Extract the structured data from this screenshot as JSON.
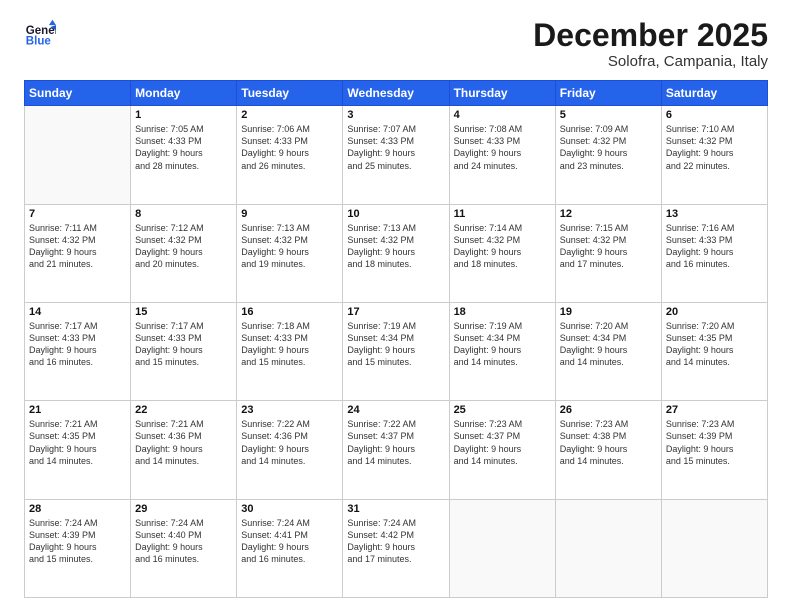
{
  "logo": {
    "line1": "General",
    "line2": "Blue"
  },
  "title": "December 2025",
  "location": "Solofra, Campania, Italy",
  "weekdays": [
    "Sunday",
    "Monday",
    "Tuesday",
    "Wednesday",
    "Thursday",
    "Friday",
    "Saturday"
  ],
  "weeks": [
    [
      {
        "day": "",
        "info": ""
      },
      {
        "day": "1",
        "info": "Sunrise: 7:05 AM\nSunset: 4:33 PM\nDaylight: 9 hours\nand 28 minutes."
      },
      {
        "day": "2",
        "info": "Sunrise: 7:06 AM\nSunset: 4:33 PM\nDaylight: 9 hours\nand 26 minutes."
      },
      {
        "day": "3",
        "info": "Sunrise: 7:07 AM\nSunset: 4:33 PM\nDaylight: 9 hours\nand 25 minutes."
      },
      {
        "day": "4",
        "info": "Sunrise: 7:08 AM\nSunset: 4:33 PM\nDaylight: 9 hours\nand 24 minutes."
      },
      {
        "day": "5",
        "info": "Sunrise: 7:09 AM\nSunset: 4:32 PM\nDaylight: 9 hours\nand 23 minutes."
      },
      {
        "day": "6",
        "info": "Sunrise: 7:10 AM\nSunset: 4:32 PM\nDaylight: 9 hours\nand 22 minutes."
      }
    ],
    [
      {
        "day": "7",
        "info": "Sunrise: 7:11 AM\nSunset: 4:32 PM\nDaylight: 9 hours\nand 21 minutes."
      },
      {
        "day": "8",
        "info": "Sunrise: 7:12 AM\nSunset: 4:32 PM\nDaylight: 9 hours\nand 20 minutes."
      },
      {
        "day": "9",
        "info": "Sunrise: 7:13 AM\nSunset: 4:32 PM\nDaylight: 9 hours\nand 19 minutes."
      },
      {
        "day": "10",
        "info": "Sunrise: 7:13 AM\nSunset: 4:32 PM\nDaylight: 9 hours\nand 18 minutes."
      },
      {
        "day": "11",
        "info": "Sunrise: 7:14 AM\nSunset: 4:32 PM\nDaylight: 9 hours\nand 18 minutes."
      },
      {
        "day": "12",
        "info": "Sunrise: 7:15 AM\nSunset: 4:32 PM\nDaylight: 9 hours\nand 17 minutes."
      },
      {
        "day": "13",
        "info": "Sunrise: 7:16 AM\nSunset: 4:33 PM\nDaylight: 9 hours\nand 16 minutes."
      }
    ],
    [
      {
        "day": "14",
        "info": "Sunrise: 7:17 AM\nSunset: 4:33 PM\nDaylight: 9 hours\nand 16 minutes."
      },
      {
        "day": "15",
        "info": "Sunrise: 7:17 AM\nSunset: 4:33 PM\nDaylight: 9 hours\nand 15 minutes."
      },
      {
        "day": "16",
        "info": "Sunrise: 7:18 AM\nSunset: 4:33 PM\nDaylight: 9 hours\nand 15 minutes."
      },
      {
        "day": "17",
        "info": "Sunrise: 7:19 AM\nSunset: 4:34 PM\nDaylight: 9 hours\nand 15 minutes."
      },
      {
        "day": "18",
        "info": "Sunrise: 7:19 AM\nSunset: 4:34 PM\nDaylight: 9 hours\nand 14 minutes."
      },
      {
        "day": "19",
        "info": "Sunrise: 7:20 AM\nSunset: 4:34 PM\nDaylight: 9 hours\nand 14 minutes."
      },
      {
        "day": "20",
        "info": "Sunrise: 7:20 AM\nSunset: 4:35 PM\nDaylight: 9 hours\nand 14 minutes."
      }
    ],
    [
      {
        "day": "21",
        "info": "Sunrise: 7:21 AM\nSunset: 4:35 PM\nDaylight: 9 hours\nand 14 minutes."
      },
      {
        "day": "22",
        "info": "Sunrise: 7:21 AM\nSunset: 4:36 PM\nDaylight: 9 hours\nand 14 minutes."
      },
      {
        "day": "23",
        "info": "Sunrise: 7:22 AM\nSunset: 4:36 PM\nDaylight: 9 hours\nand 14 minutes."
      },
      {
        "day": "24",
        "info": "Sunrise: 7:22 AM\nSunset: 4:37 PM\nDaylight: 9 hours\nand 14 minutes."
      },
      {
        "day": "25",
        "info": "Sunrise: 7:23 AM\nSunset: 4:37 PM\nDaylight: 9 hours\nand 14 minutes."
      },
      {
        "day": "26",
        "info": "Sunrise: 7:23 AM\nSunset: 4:38 PM\nDaylight: 9 hours\nand 14 minutes."
      },
      {
        "day": "27",
        "info": "Sunrise: 7:23 AM\nSunset: 4:39 PM\nDaylight: 9 hours\nand 15 minutes."
      }
    ],
    [
      {
        "day": "28",
        "info": "Sunrise: 7:24 AM\nSunset: 4:39 PM\nDaylight: 9 hours\nand 15 minutes."
      },
      {
        "day": "29",
        "info": "Sunrise: 7:24 AM\nSunset: 4:40 PM\nDaylight: 9 hours\nand 16 minutes."
      },
      {
        "day": "30",
        "info": "Sunrise: 7:24 AM\nSunset: 4:41 PM\nDaylight: 9 hours\nand 16 minutes."
      },
      {
        "day": "31",
        "info": "Sunrise: 7:24 AM\nSunset: 4:42 PM\nDaylight: 9 hours\nand 17 minutes."
      },
      {
        "day": "",
        "info": ""
      },
      {
        "day": "",
        "info": ""
      },
      {
        "day": "",
        "info": ""
      }
    ]
  ]
}
